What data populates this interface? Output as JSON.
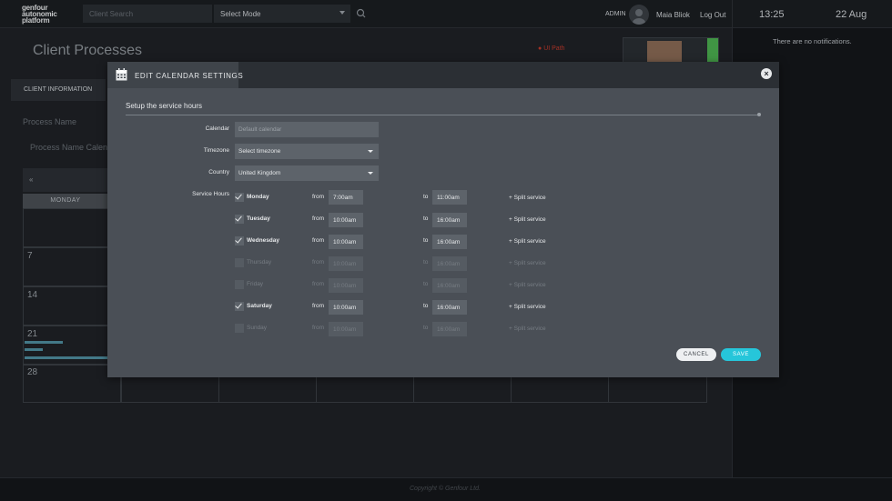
{
  "app": {
    "logo_lines": [
      "genfour",
      "autonomic",
      "platform"
    ]
  },
  "topbar": {
    "search_placeholder": "Client Search",
    "mode_label": "Select Mode",
    "role": "ADMIN",
    "username": "Maia Bliok",
    "logout": "Log Out",
    "time": "13:25",
    "date": "22 Aug"
  },
  "notifications": {
    "empty_text": "There are no notifications."
  },
  "page": {
    "title": "Client Processes",
    "badge": "UI Path",
    "tab": "CLIENT INFORMATION",
    "process_name_label": "Process Name",
    "process_name_value": "Process Name Calen",
    "calendar": {
      "prev": "«",
      "day_header": "MONDAY",
      "week_numbers": [
        "7",
        "14",
        "21",
        "28"
      ]
    }
  },
  "footer": {
    "copyright": "Copyright © Genfour Ltd."
  },
  "modal": {
    "title": "EDIT CALENDAR SETTINGS",
    "close": "×",
    "section_title": "Setup the service hours",
    "calendar_label": "Calendar",
    "calendar_placeholder": "Default calendar",
    "timezone_label": "Timezone",
    "timezone_value": "Select timezone",
    "country_label": "Country",
    "country_value": "United Kingdom",
    "service_hours_label": "Service Hours",
    "from_label": "from",
    "to_label": "to",
    "split_label": "+ Split service",
    "days": [
      {
        "name": "Monday",
        "checked": true,
        "from": "7:00am",
        "to": "11:00am"
      },
      {
        "name": "Tuesday",
        "checked": true,
        "from": "10:00am",
        "to": "16:00am"
      },
      {
        "name": "Wednesday",
        "checked": true,
        "from": "10:00am",
        "to": "16:00am"
      },
      {
        "name": "Thursday",
        "checked": false,
        "from": "10:00am",
        "to": "16:00am"
      },
      {
        "name": "Friday",
        "checked": false,
        "from": "10:00am",
        "to": "16:00am"
      },
      {
        "name": "Saturday",
        "checked": true,
        "from": "10:00am",
        "to": "16:00am"
      },
      {
        "name": "Sunday",
        "checked": false,
        "from": "10:00am",
        "to": "16:00am"
      }
    ],
    "cancel": "CANCEL",
    "save": "SAVE"
  },
  "colors": {
    "accent": "#26c6da",
    "badge": "#c0392b",
    "modal_bg": "#4a4f56"
  }
}
